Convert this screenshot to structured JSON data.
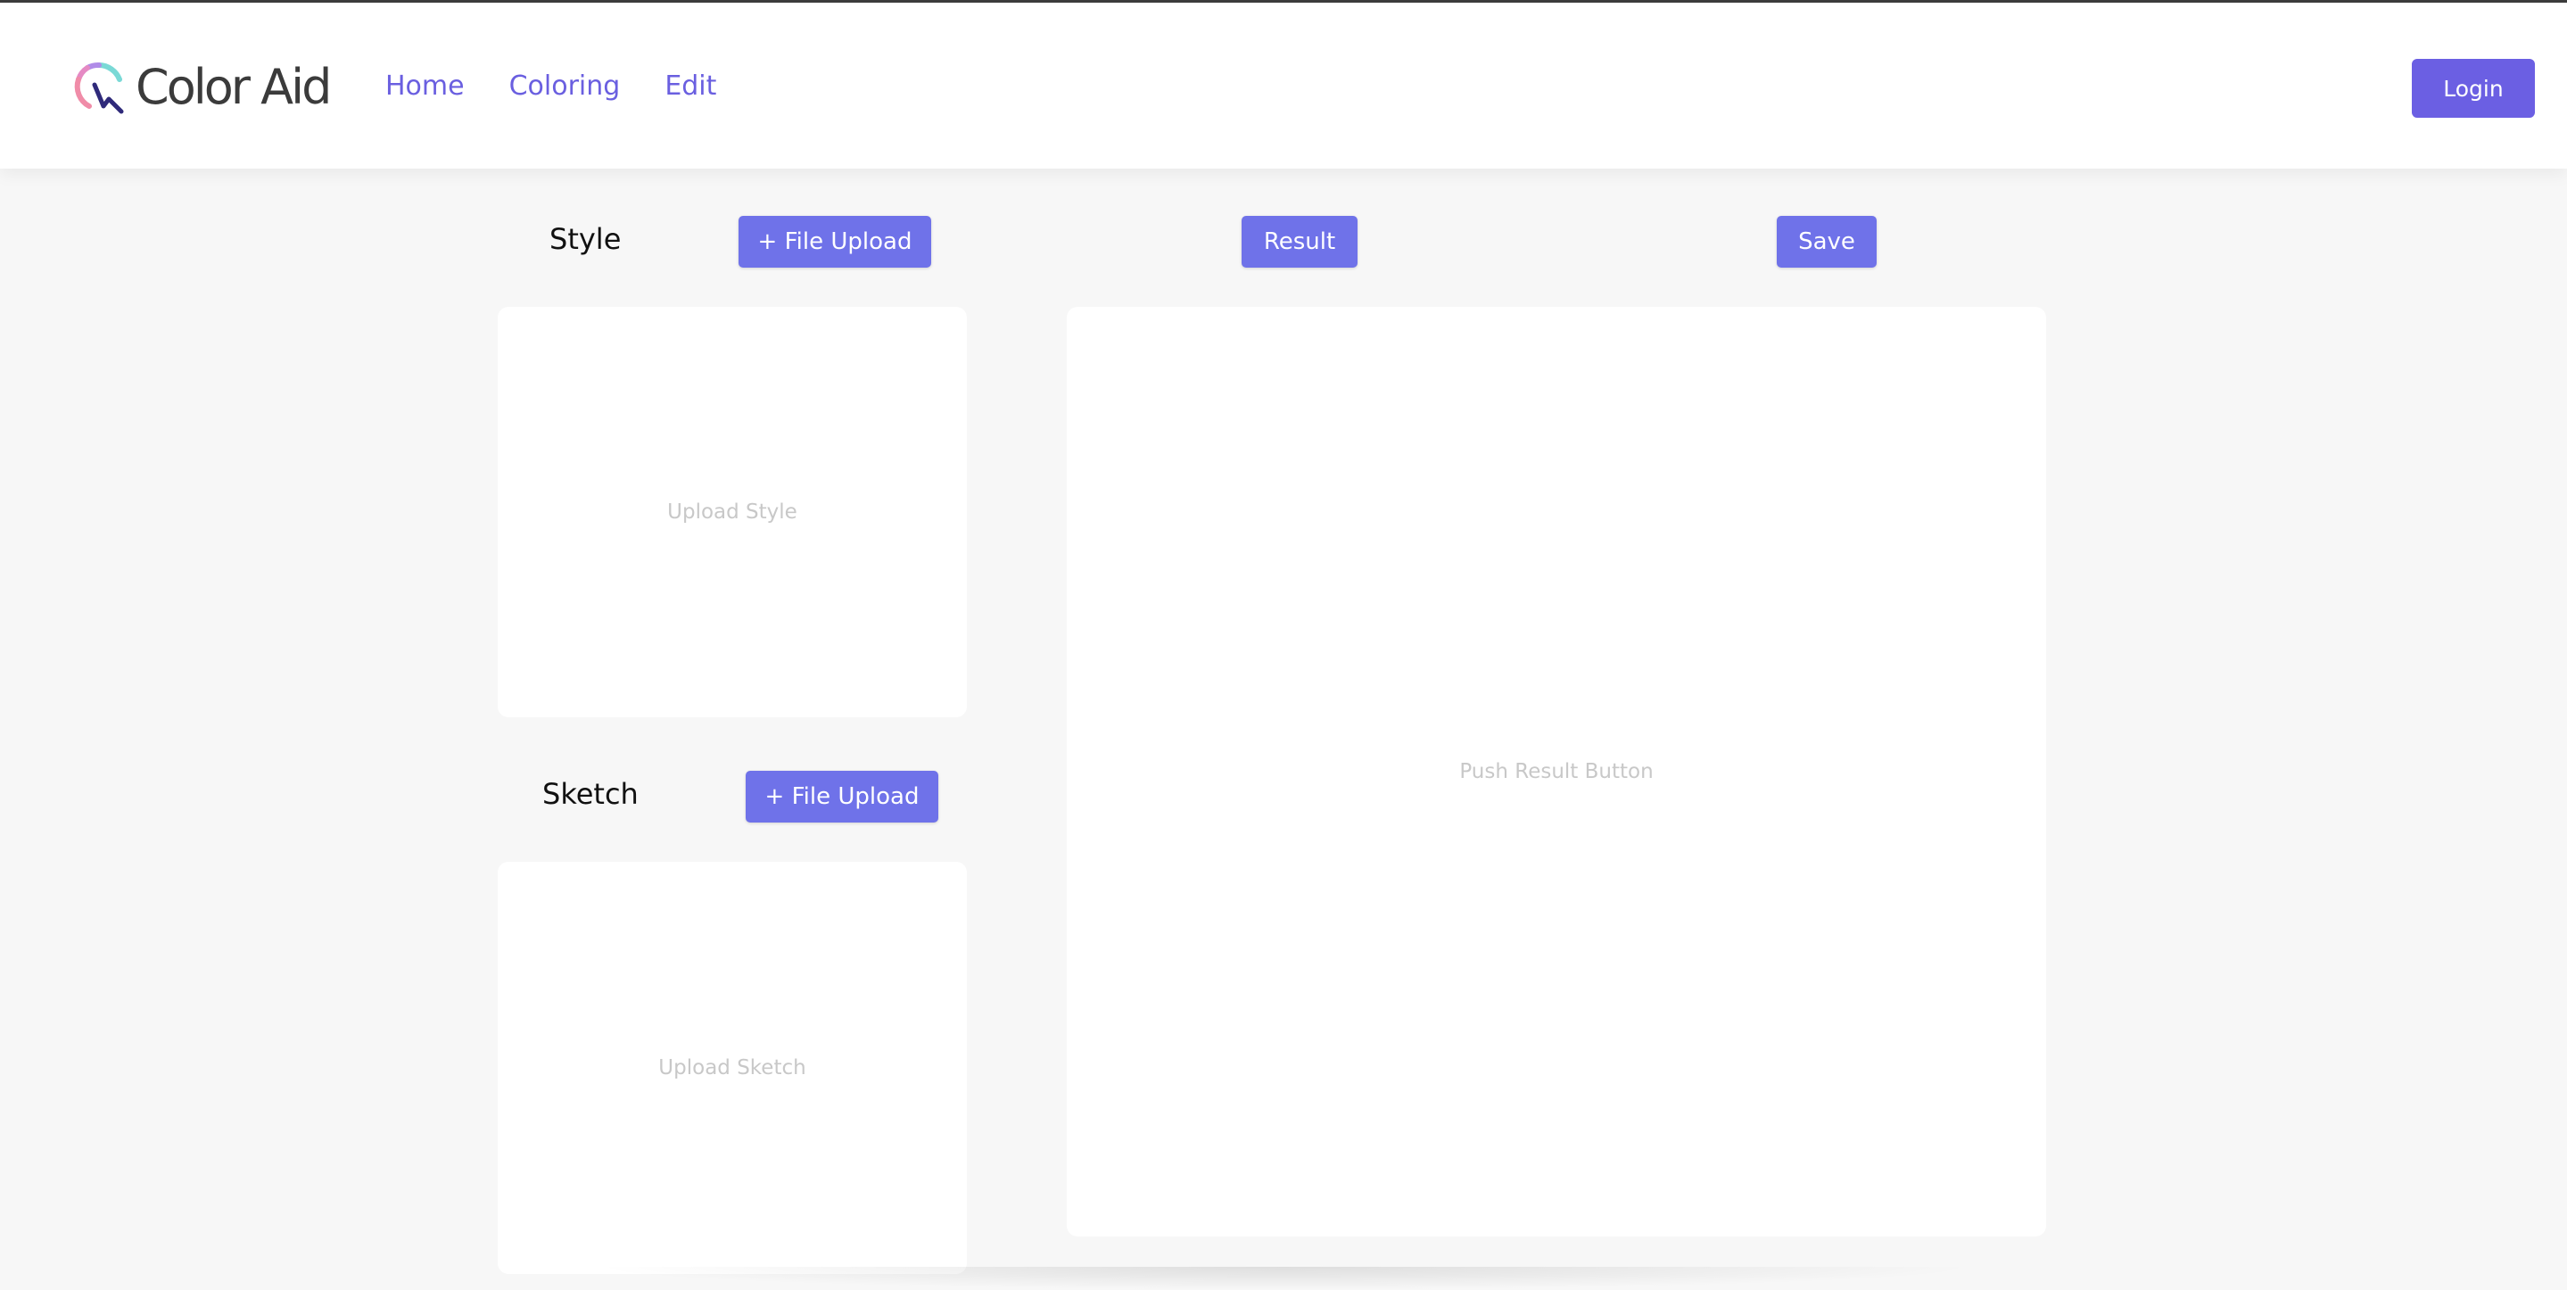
{
  "app": {
    "logo_text": "Color Aid",
    "logo_icon": "color-aid-logo-icon"
  },
  "nav": {
    "items": [
      {
        "label": "Home"
      },
      {
        "label": "Coloring"
      },
      {
        "label": "Edit"
      }
    ],
    "login_label": "Login"
  },
  "style_section": {
    "title": "Style",
    "upload_label": "+ File Upload",
    "placeholder": "Upload Style"
  },
  "sketch_section": {
    "title": "Sketch",
    "upload_label": "+ File Upload",
    "placeholder": "Upload Sketch"
  },
  "result_section": {
    "result_label": "Result",
    "save_label": "Save",
    "placeholder": "Push Result Button"
  },
  "colors": {
    "accent": "#6b5fe3",
    "button": "#6f72e9",
    "nav_text": "#6a5fe0",
    "background": "#f7f7f7"
  }
}
